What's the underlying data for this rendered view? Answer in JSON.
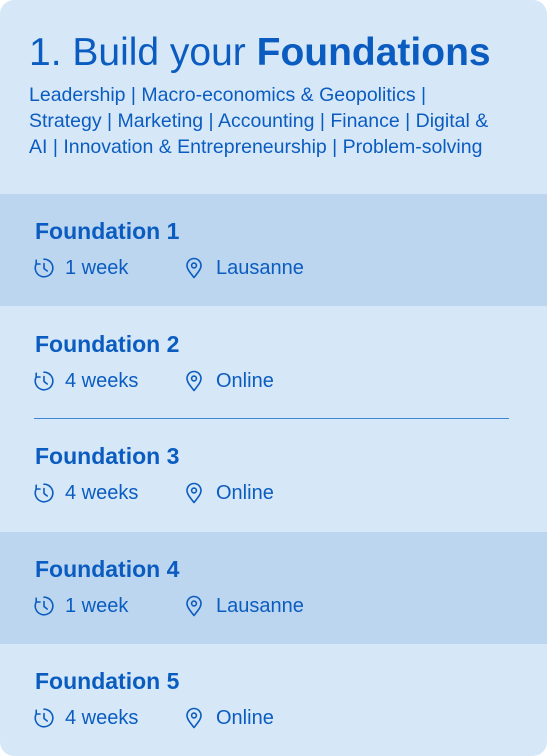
{
  "header": {
    "title_prefix": "1. Build your ",
    "title_bold": "Foundations",
    "subtitle": "Leadership | Macro-economics & Geopolitics | Strategy | Marketing | Accounting | Finance | Digital & AI | Innovation & Entrepreneurship | Problem-solving"
  },
  "icons": {
    "duration": "clock-icon",
    "location": "location-pin-icon"
  },
  "colors": {
    "card_background": "#d6e8f7",
    "highlight_row": "#bdd6f0",
    "text": "#0b5cc0"
  },
  "foundations": [
    {
      "title": "Foundation 1",
      "duration": "1 week",
      "location": "Lausanne"
    },
    {
      "title": "Foundation 2",
      "duration": "4 weeks",
      "location": "Online"
    },
    {
      "title": "Foundation 3",
      "duration": "4 weeks",
      "location": "Online"
    },
    {
      "title": "Foundation 4",
      "duration": "1 week",
      "location": "Lausanne"
    },
    {
      "title": "Foundation 5",
      "duration": "4 weeks",
      "location": "Online"
    }
  ]
}
